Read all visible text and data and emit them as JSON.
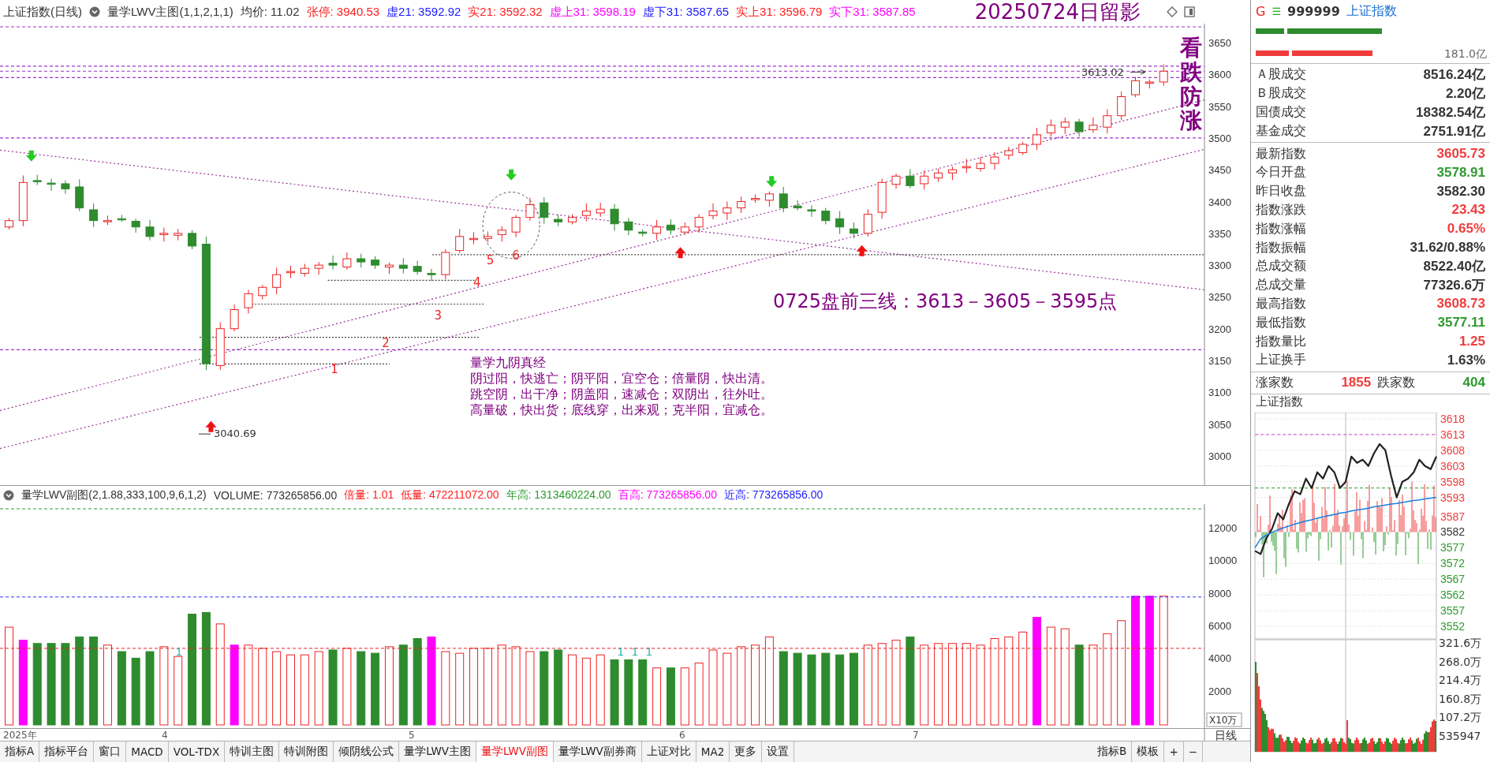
{
  "header": {
    "symbol": "上证指数(日线)",
    "indicator": "量学LWV主图(1,1,2,1,1)",
    "values": [
      {
        "text": "均价: 11.02",
        "color": "#333333"
      },
      {
        "text": "张停: 3940.53",
        "color": "#ff2020"
      },
      {
        "text": "虚21: 3592.92",
        "color": "#1a1aff"
      },
      {
        "text": "实21: 3592.32",
        "color": "#ff2020"
      },
      {
        "text": "虚上31: 3598.19",
        "color": "#ff00ff"
      },
      {
        "text": "虚下31: 3587.65",
        "color": "#1a1aff"
      },
      {
        "text": "实上31: 3596.79",
        "color": "#ff2020"
      },
      {
        "text": "实下31: 3587.85",
        "color": "#ff00ff"
      }
    ],
    "snapshot_title": "20250724日留影"
  },
  "main_chart": {
    "vertical_note": "看跌防涨",
    "high_label": "3613.02",
    "low_label": "3040.69",
    "level_numbers": [
      "1",
      "2",
      "3",
      "4",
      "5",
      "6"
    ],
    "forecast": "0725盘前三线：3613－3605－3595点",
    "verse": {
      "title": "量学九阴真经",
      "lines": [
        "阴过阳，快逃亡；阴平阳，宜空仓；倍量阴，快出清。",
        "跳空阴，出干净；阴盖阳，速减仓；双阴出，往外吐。",
        "高量破，快出货；底线穿，出来观；克半阳，宜减仓。"
      ]
    },
    "price_axis": [
      "3650",
      "3600",
      "3550",
      "3500",
      "3450",
      "3400",
      "3350",
      "3300",
      "3250",
      "3200",
      "3150",
      "3100",
      "3050",
      "3000"
    ]
  },
  "sub_header": {
    "indicator": "量学LWV副图(2,1.88,333,100,9,6,1,2)",
    "values": [
      {
        "text": "VOLUME: 773265856.00",
        "color": "#333333"
      },
      {
        "text": "倍量: 1.01",
        "color": "#ff2020"
      },
      {
        "text": "低量: 472211072.00",
        "color": "#ff2020"
      },
      {
        "text": "年高: 1313460224.00",
        "color": "#2e9a2e"
      },
      {
        "text": "百高: 773265856.00",
        "color": "#ff00ff"
      },
      {
        "text": "近高: 773265856.00",
        "color": "#1a1aff"
      }
    ]
  },
  "sub_chart": {
    "axis": [
      "12000",
      "10000",
      "8000",
      "6000",
      "4000",
      "2000"
    ],
    "unit": "X10万",
    "marks": [
      "1",
      "1",
      "1",
      "1"
    ]
  },
  "date_axis": [
    "2025年",
    "4",
    "5",
    "6",
    "7"
  ],
  "period": "日线",
  "tabs": [
    {
      "label": "指标A",
      "selected": false
    },
    {
      "label": "指标平台",
      "selected": false
    },
    {
      "label": "窗口",
      "selected": false
    },
    {
      "label": "MACD",
      "selected": false
    },
    {
      "label": "VOL-TDX",
      "selected": false
    },
    {
      "label": "特训主图",
      "selected": false
    },
    {
      "label": "特训附图",
      "selected": false
    },
    {
      "label": "倾阴线公式",
      "selected": false
    },
    {
      "label": "量学LWV主图",
      "selected": false
    },
    {
      "label": "量学LWV副图",
      "selected": true
    },
    {
      "label": "量学LWV副券商",
      "selected": false
    },
    {
      "label": "上证对比",
      "selected": false
    },
    {
      "label": "MA2",
      "selected": false
    },
    {
      "label": "更多",
      "selected": false
    },
    {
      "label": "设置",
      "selected": false
    }
  ],
  "right_tabs": [
    "指标B",
    "模板",
    "+",
    "−"
  ],
  "quote": {
    "g": "G",
    "menu": "☰",
    "code": "999999",
    "name": "上证指数",
    "amount": "181.0亿",
    "turnover": [
      {
        "label": "Ａ股成交",
        "value": "8516.24亿",
        "color": "#333333"
      },
      {
        "label": "Ｂ股成交",
        "value": "2.20亿",
        "color": "#333333"
      },
      {
        "label": "国债成交",
        "value": "18382.54亿",
        "color": "#333333"
      },
      {
        "label": "基金成交",
        "value": "2751.91亿",
        "color": "#333333"
      }
    ],
    "stats": [
      {
        "label": "最新指数",
        "value": "3605.73",
        "color": "#f03c3c"
      },
      {
        "label": "今日开盘",
        "value": "3578.91",
        "color": "#2e9a2e"
      },
      {
        "label": "昨日收盘",
        "value": "3582.30",
        "color": "#333333"
      },
      {
        "label": "指数涨跌",
        "value": "23.43",
        "color": "#f03c3c"
      },
      {
        "label": "指数涨幅",
        "value": "0.65%",
        "color": "#f03c3c"
      },
      {
        "label": "指数振幅",
        "value": "31.62/0.88%",
        "color": "#333333"
      },
      {
        "label": "总成交额",
        "value": "8522.40亿",
        "color": "#333333"
      },
      {
        "label": "总成交量",
        "value": "77326.6万",
        "color": "#333333"
      },
      {
        "label": "最高指数",
        "value": "3608.73",
        "color": "#f03c3c"
      },
      {
        "label": "最低指数",
        "value": "3577.11",
        "color": "#2e9a2e"
      },
      {
        "label": "指数量比",
        "value": "1.25",
        "color": "#f03c3c"
      },
      {
        "label": "上证换手",
        "value": "1.63%",
        "color": "#333333"
      }
    ],
    "breadth": {
      "up_label": "涨家数",
      "up": "1855",
      "down_label": "跌家数",
      "down": "404"
    },
    "intraday": {
      "title": "上证指数",
      "chart_data": {
        "type": "line",
        "series": [
          {
            "color": "#222222",
            "values": [
              3576,
              3575,
              3580,
              3583,
              3588,
              3586,
              3591,
              3595,
              3594,
              3599,
              3596,
              3601,
              3599,
              3603,
              3601,
              3596,
              3598,
              3606,
              3604,
              3605,
              3603,
              3607,
              3610,
              3608,
              3600,
              3593,
              3598,
              3599,
              3601,
              3605,
              3603,
              3602,
              3606
            ]
          },
          {
            "color": "#1a7fe0",
            "values": [
              3577,
              3579.8,
              3581,
              3581.9,
              3582.7,
              3583.3,
              3583.9,
              3584.5,
              3585,
              3585.5,
              3585.9,
              3586.4,
              3586.8,
              3587.2,
              3587.6,
              3588,
              3588.3,
              3588.7,
              3589,
              3589.3,
              3589.6,
              3590,
              3590.3,
              3590.6,
              3590.9,
              3591.1,
              3591.4,
              3591.7,
              3592,
              3592.2,
              3592.5,
              3592.8,
              3593
            ]
          }
        ],
        "ylim": [
          3548,
          3620
        ],
        "grid": true,
        "yticks": [
          {
            "value": 3618,
            "label": "3618"
          },
          {
            "value": 3613,
            "label": "3613"
          },
          {
            "value": 3608,
            "label": "3608"
          },
          {
            "value": 3603,
            "label": "3603"
          },
          {
            "value": 3598,
            "label": "3598"
          },
          {
            "value": 3593,
            "label": "3593"
          },
          {
            "value": 3587,
            "label": "3587"
          },
          {
            "value": 3582,
            "label": "3582"
          },
          {
            "value": 3577,
            "label": "3577"
          },
          {
            "value": 3572,
            "label": "3572"
          },
          {
            "value": 3567,
            "label": "3567"
          },
          {
            "value": 3562,
            "label": "3562"
          },
          {
            "value": 3557,
            "label": "3557"
          },
          {
            "value": 3552,
            "label": "3552"
          }
        ]
      },
      "volume_ticks": [
        "321.6万",
        "268.0万",
        "214.4万",
        "160.8万",
        "107.2万",
        "535947"
      ]
    }
  }
}
